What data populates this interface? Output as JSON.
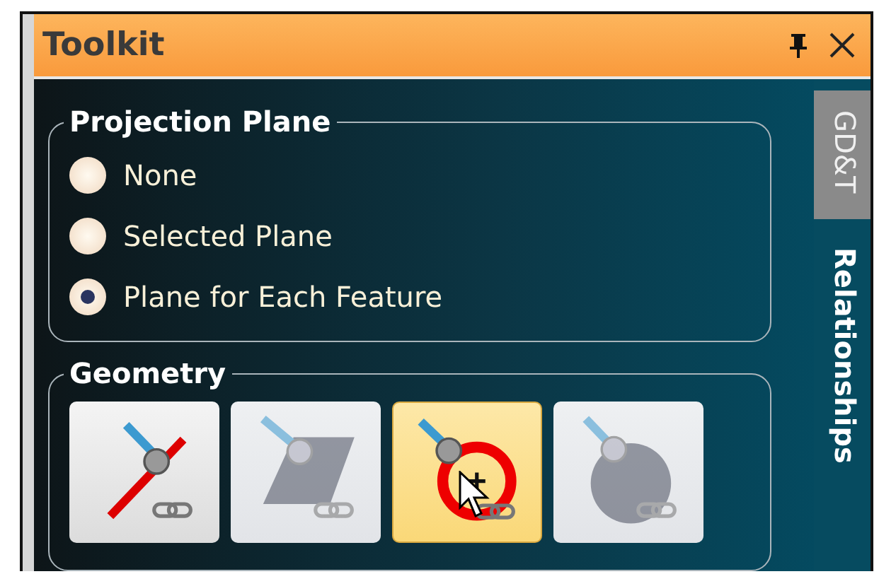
{
  "window": {
    "title": "Toolkit"
  },
  "side_tabs": [
    {
      "label": "GD&T",
      "selected": false
    },
    {
      "label": "Relationships",
      "selected": true
    }
  ],
  "projection_plane": {
    "title": "Projection Plane",
    "options": [
      {
        "label": "None",
        "selected": false
      },
      {
        "label": "Selected Plane",
        "selected": false
      },
      {
        "label": "Plane for Each Feature",
        "selected": true
      }
    ]
  },
  "geometry": {
    "title": "Geometry",
    "tools": [
      {
        "kind": "line",
        "disabled": false,
        "selected": false
      },
      {
        "kind": "plane",
        "disabled": true,
        "selected": false
      },
      {
        "kind": "circle",
        "disabled": false,
        "selected": true
      },
      {
        "kind": "sphere",
        "disabled": true,
        "selected": false
      }
    ]
  }
}
